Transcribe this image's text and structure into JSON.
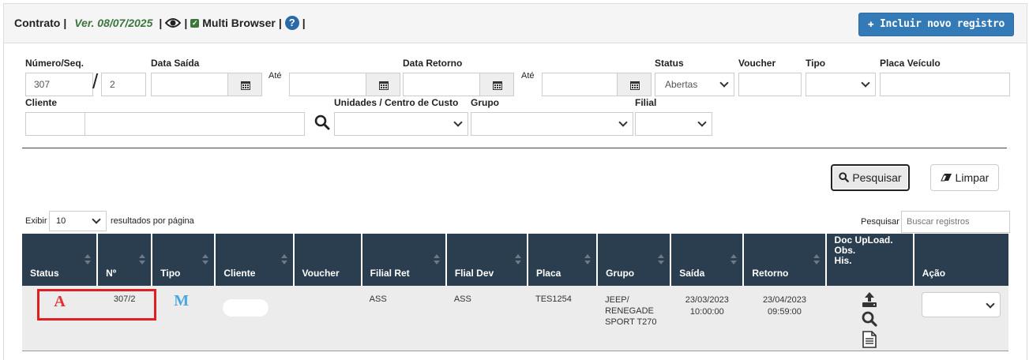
{
  "header": {
    "title": "Contrato",
    "version": "Ver. 08/07/2025",
    "multi_browser": "Multi Browser",
    "new_button": "Incluir novo registro",
    "pipe": "|"
  },
  "filters": {
    "numero_label": "Número/Seq.",
    "numero_value": "307",
    "seq_value": "2",
    "data_saida_label": "Data Saída",
    "ate_label_1": "Até",
    "data_retorno_label": "Data Retorno",
    "ate_label_2": "Até",
    "status_label": "Status",
    "status_value": "Abertas",
    "voucher_label": "Voucher",
    "tipo_label": "Tipo",
    "placa_label": "Placa Veículo",
    "cliente_label": "Cliente",
    "unidades_label": "Unidades / Centro de Custo",
    "grupo_label": "Grupo",
    "filial_label": "Filial"
  },
  "actions": {
    "search_button": "Pesquisar",
    "clear_button": "Limpar"
  },
  "table_controls": {
    "show_label": "Exibir",
    "page_size": "10",
    "per_page_label": "resultados por página",
    "search_label": "Pesquisar",
    "search_placeholder": "Buscar registros"
  },
  "table": {
    "columns": [
      "Status",
      "Nº",
      "Tipo",
      "Cliente",
      "Voucher",
      "Filial Ret",
      "Flial Dev",
      "Placa",
      "Grupo",
      "Saída",
      "Retorno",
      "Doc UpLoad.\nObs.\nHis.",
      "Ação"
    ],
    "doc_col": [
      "Doc UpLoad.",
      "Obs.",
      "His."
    ],
    "rows": [
      {
        "status": "A",
        "numero": "307/2",
        "tipo": "M",
        "cliente": "",
        "voucher": "",
        "filial_ret": "ASS",
        "filial_dev": "ASS",
        "placa": "TES1254",
        "grupo": [
          "JEEP/",
          "RENEGADE",
          "SPORT T270"
        ],
        "saida": [
          "23/03/2023",
          "10:00:00"
        ],
        "retorno": [
          "23/04/2023",
          "09:59:00"
        ]
      }
    ]
  },
  "colors": {
    "primary": "#337ab7",
    "table_header": "#2b3e50",
    "version_green": "#3c763d",
    "status_red": "#e03030",
    "tipo_blue": "#4aa8e0",
    "highlight_red": "#e02020"
  },
  "icons": [
    "eye-icon",
    "checkbox-icon",
    "help-icon",
    "plus-icon",
    "calendar-icon",
    "search-icon",
    "eraser-icon",
    "upload-icon",
    "document-icon",
    "chevron-down-icon"
  ]
}
